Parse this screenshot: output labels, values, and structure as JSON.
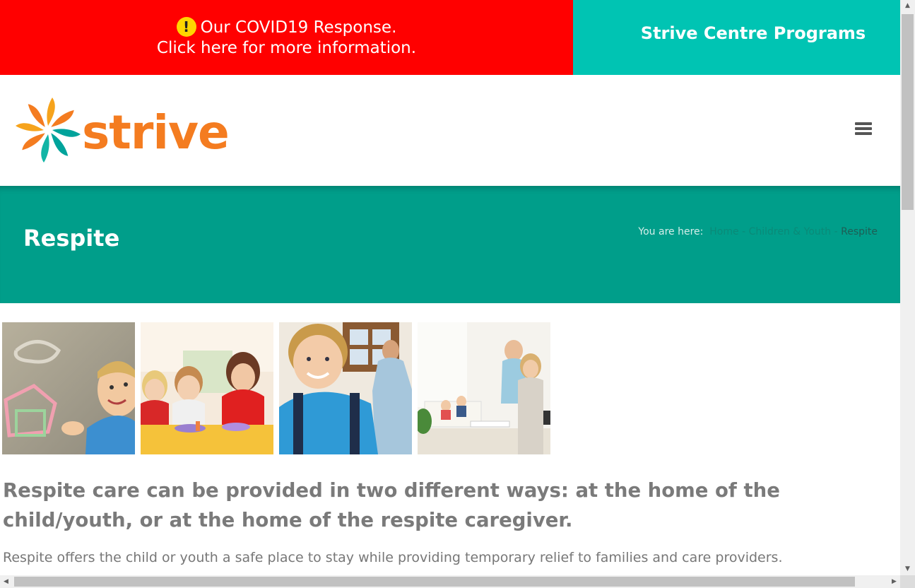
{
  "banner": {
    "covid_line1": "Our COVID19 Response.",
    "covid_line2": "Click here for more information.",
    "alert_icon": "!",
    "programs": "Strive Centre Programs",
    "covid_color": "#ff0000",
    "programs_color": "#00c4b3"
  },
  "header": {
    "logo_text": "strive",
    "logo_icon": "pinwheel-logo-icon",
    "menu_icon": "hamburger-menu-icon"
  },
  "title_bar": {
    "title": "Respite",
    "breadcrumb_prefix": "You are here:",
    "crumbs": [
      "Home",
      "Children & Youth",
      "Respite"
    ],
    "separator": "-",
    "color": "#009e8a"
  },
  "gallery": {
    "photos": [
      "child-drawing-chalk-photo",
      "kids-crafting-with-caregiver-photo",
      "boy-with-backpack-and-father-photo",
      "family-in-living-room-photo"
    ]
  },
  "content": {
    "lead": "Respite care can be provided in two different ways: at the home of the child/youth, or at the home of the respite caregiver.",
    "body": "Respite offers the child or youth a safe place to stay while providing temporary relief to families and care providers."
  },
  "brand_colors": {
    "orange": "#f47c20",
    "teal": "#00a39b"
  }
}
